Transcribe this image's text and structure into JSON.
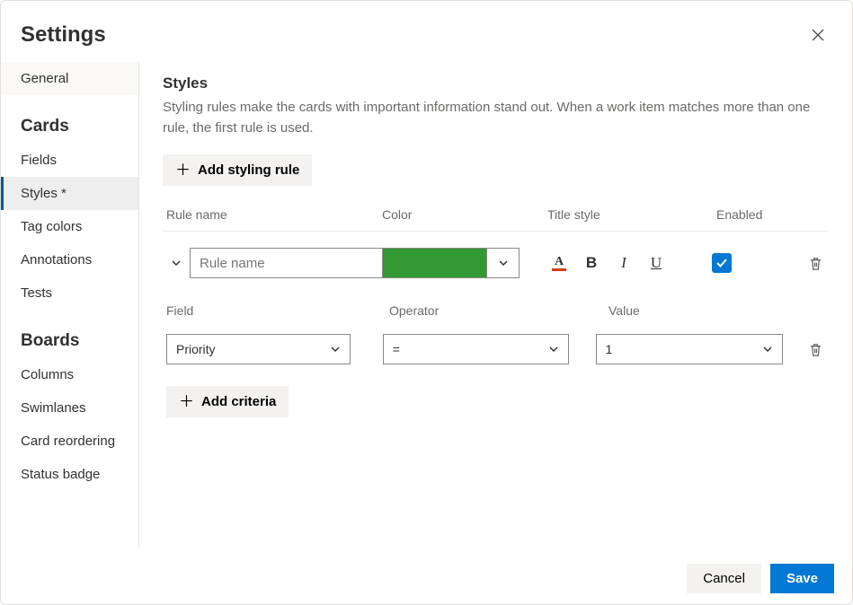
{
  "header": {
    "title": "Settings"
  },
  "sidebar": {
    "general": "General",
    "cards_heading": "Cards",
    "cards": [
      "Fields",
      "Styles *",
      "Tag colors",
      "Annotations",
      "Tests"
    ],
    "boards_heading": "Boards",
    "boards": [
      "Columns",
      "Swimlanes",
      "Card reordering",
      "Status badge"
    ]
  },
  "main": {
    "title": "Styles",
    "description": "Styling rules make the cards with important information stand out. When a work item matches more than one rule, the first rule is used.",
    "add_rule_label": "Add styling rule",
    "columns": {
      "name": "Rule name",
      "color": "Color",
      "title_style": "Title style",
      "enabled": "Enabled"
    },
    "rule": {
      "name_placeholder": "Rule name",
      "name_value": "",
      "color": "#339933",
      "enabled": true
    },
    "criteria_columns": {
      "field": "Field",
      "operator": "Operator",
      "value": "Value"
    },
    "criteria_row": {
      "field": "Priority",
      "operator": "=",
      "value": "1"
    },
    "add_criteria_label": "Add criteria"
  },
  "footer": {
    "cancel": "Cancel",
    "save": "Save"
  }
}
